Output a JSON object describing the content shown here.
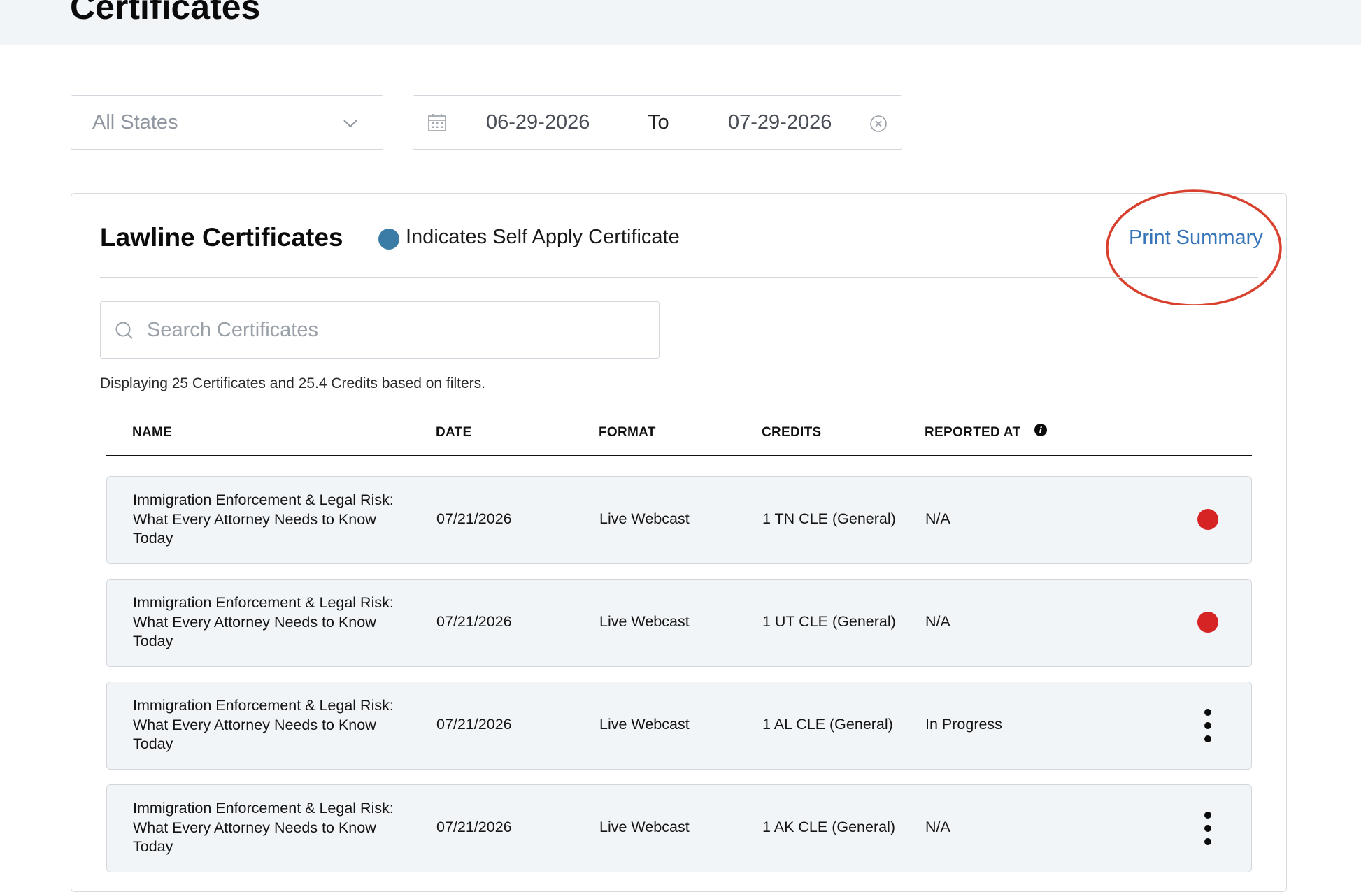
{
  "page": {
    "title": "Certificates"
  },
  "filters": {
    "state_select": {
      "value": "All States"
    },
    "date_range": {
      "start": "06-29-2026",
      "separator": "To",
      "end": "07-29-2026"
    }
  },
  "card": {
    "title": "Lawline Certificates",
    "legend": {
      "text": "Indicates Self Apply Certificate",
      "color": "#3a7ca5"
    },
    "print_summary_label": "Print Summary",
    "search": {
      "placeholder": "Search Certificates",
      "value": ""
    },
    "summary_text": "Displaying 25 Certificates and 25.4 Credits based on filters."
  },
  "table": {
    "columns": [
      "NAME",
      "DATE",
      "FORMAT",
      "CREDITS",
      "REPORTED AT"
    ],
    "rows": [
      {
        "name": "Immigration Enforcement & Legal Risk: What Every Attorney Needs to Know Today",
        "date": "07/21/2026",
        "format": "Live Webcast",
        "credits": "1 TN CLE (General)",
        "reported_at": "N/A",
        "action": "status-dot"
      },
      {
        "name": "Immigration Enforcement & Legal Risk: What Every Attorney Needs to Know Today",
        "date": "07/21/2026",
        "format": "Live Webcast",
        "credits": "1 UT CLE (General)",
        "reported_at": "N/A",
        "action": "status-dot"
      },
      {
        "name": "Immigration Enforcement & Legal Risk: What Every Attorney Needs to Know Today",
        "date": "07/21/2026",
        "format": "Live Webcast",
        "credits": "1 AL CLE (General)",
        "reported_at": "In Progress",
        "action": "kebab-menu"
      },
      {
        "name": "Immigration Enforcement & Legal Risk: What Every Attorney Needs to Know Today",
        "date": "07/21/2026",
        "format": "Live Webcast",
        "credits": "1 AK CLE (General)",
        "reported_at": "N/A",
        "action": "kebab-menu"
      }
    ]
  },
  "colors": {
    "accent_link": "#3674b8",
    "status_dot": "#d62424",
    "self_apply_dot": "#3a7ca5",
    "annotation_circle": "#d9412f",
    "row_bg": "#f2f5f8"
  },
  "icons": [
    "chevron-down-icon",
    "calendar-icon",
    "clear-circle-icon",
    "search-icon",
    "info-icon",
    "kebab-menu-icon"
  ]
}
